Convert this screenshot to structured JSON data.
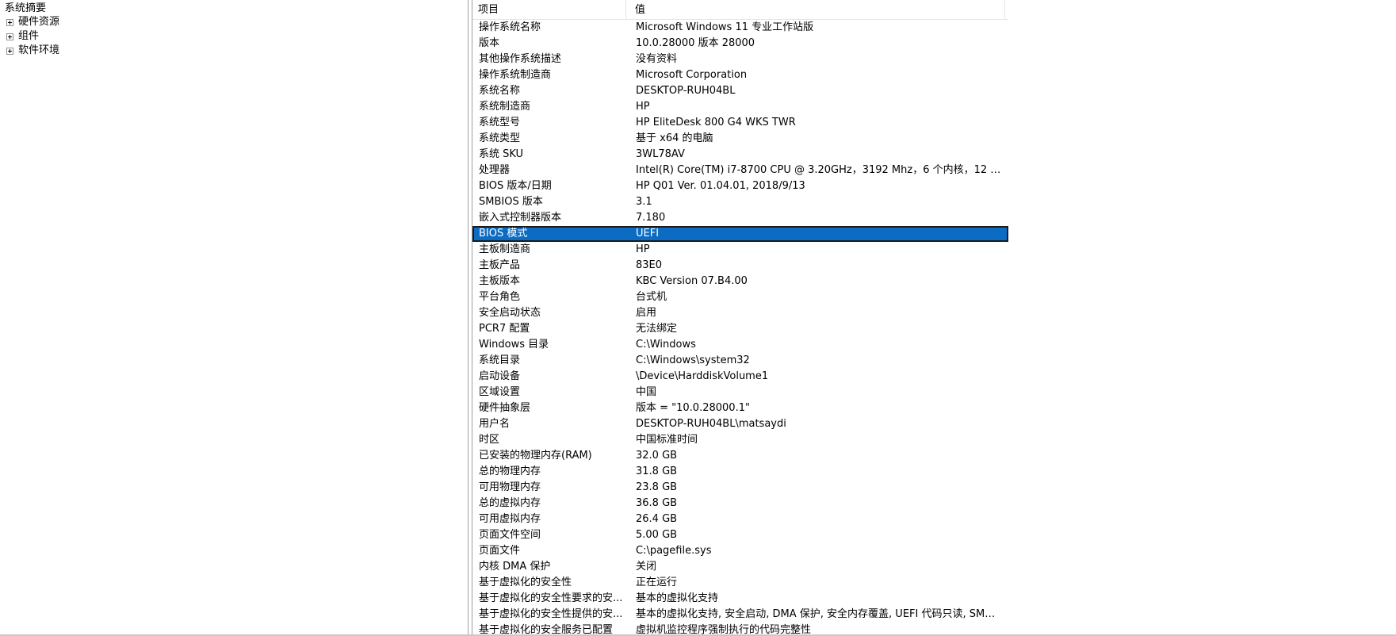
{
  "tree": {
    "root_label": "系统摘要",
    "children": [
      {
        "label": "硬件资源"
      },
      {
        "label": "组件"
      },
      {
        "label": "软件环境"
      }
    ]
  },
  "list": {
    "headers": {
      "item": "项目",
      "value": "值"
    },
    "rows": [
      {
        "item": "操作系统名称",
        "value": "Microsoft Windows 11 专业工作站版"
      },
      {
        "item": "版本",
        "value": "10.0.28000 版本 28000"
      },
      {
        "item": "其他操作系统描述",
        "value": "没有资料"
      },
      {
        "item": "操作系统制造商",
        "value": "Microsoft Corporation"
      },
      {
        "item": "系统名称",
        "value": "DESKTOP-RUH04BL"
      },
      {
        "item": "系统制造商",
        "value": "HP"
      },
      {
        "item": "系统型号",
        "value": "HP EliteDesk 800 G4 WKS TWR"
      },
      {
        "item": "系统类型",
        "value": "基于 x64 的电脑"
      },
      {
        "item": "系统 SKU",
        "value": "3WL78AV"
      },
      {
        "item": "处理器",
        "value": "Intel(R) Core(TM) i7-8700 CPU @ 3.20GHz，3192 Mhz，6 个内核，12 个..."
      },
      {
        "item": "BIOS 版本/日期",
        "value": "HP Q01 Ver. 01.04.01, 2018/9/13"
      },
      {
        "item": "SMBIOS 版本",
        "value": "3.1"
      },
      {
        "item": "嵌入式控制器版本",
        "value": "7.180"
      },
      {
        "item": "BIOS 模式",
        "value": "UEFI",
        "selected": true
      },
      {
        "item": "主板制造商",
        "value": "HP"
      },
      {
        "item": "主板产品",
        "value": "83E0"
      },
      {
        "item": "主板版本",
        "value": "KBC Version 07.B4.00"
      },
      {
        "item": "平台角色",
        "value": "台式机"
      },
      {
        "item": "安全启动状态",
        "value": "启用"
      },
      {
        "item": "PCR7 配置",
        "value": "无法绑定"
      },
      {
        "item": "Windows 目录",
        "value": "C:\\Windows"
      },
      {
        "item": "系统目录",
        "value": "C:\\Windows\\system32"
      },
      {
        "item": "启动设备",
        "value": "\\Device\\HarddiskVolume1"
      },
      {
        "item": "区域设置",
        "value": "中国"
      },
      {
        "item": "硬件抽象层",
        "value": "版本 = \"10.0.28000.1\""
      },
      {
        "item": "用户名",
        "value": "DESKTOP-RUH04BL\\matsaydi"
      },
      {
        "item": "时区",
        "value": "中国标准时间"
      },
      {
        "item": "已安装的物理内存(RAM)",
        "value": "32.0 GB"
      },
      {
        "item": "总的物理内存",
        "value": "31.8 GB"
      },
      {
        "item": "可用物理内存",
        "value": "23.8 GB"
      },
      {
        "item": "总的虚拟内存",
        "value": "36.8 GB"
      },
      {
        "item": "可用虚拟内存",
        "value": "26.4 GB"
      },
      {
        "item": "页面文件空间",
        "value": "5.00 GB"
      },
      {
        "item": "页面文件",
        "value": "C:\\pagefile.sys"
      },
      {
        "item": "内核 DMA 保护",
        "value": "关闭"
      },
      {
        "item": "基于虚拟化的安全性",
        "value": "正在运行"
      },
      {
        "item": "基于虚拟化的安全性要求的安...",
        "value": "基本的虚拟化支持"
      },
      {
        "item": "基于虚拟化的安全性提供的安...",
        "value": "基本的虚拟化支持, 安全启动, DMA 保护, 安全内存覆盖, UEFI 代码只读, SMM..."
      },
      {
        "item": "基于虚拟化的安全服务已配置",
        "value": "虚拟机监控程序强制执行的代码完整性"
      }
    ]
  },
  "colors": {
    "selection": "#0c6cc4",
    "selection_border": "#1a1a1a"
  }
}
